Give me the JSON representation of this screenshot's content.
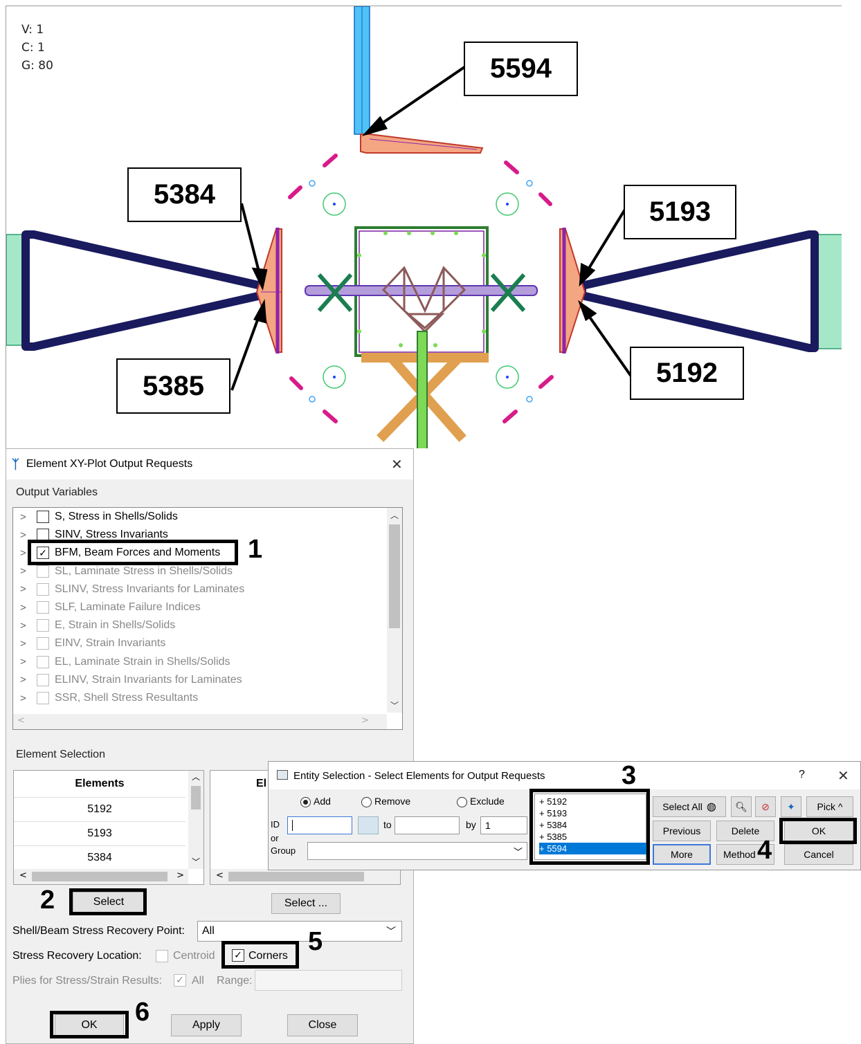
{
  "viewport": {
    "counts": [
      "V: 1",
      "C: 1",
      "G: 80"
    ],
    "callouts": [
      "5594",
      "5384",
      "5193",
      "5385",
      "5192"
    ]
  },
  "main_dialog": {
    "title": "Element XY-Plot Output Requests",
    "close": "✕",
    "output_variables_label": "Output Variables",
    "variables": [
      {
        "label": "S, Stress in Shells/Solids",
        "checked": false,
        "enabled": true
      },
      {
        "label": "SINV, Stress Invariants",
        "checked": false,
        "enabled": true
      },
      {
        "label": "BFM, Beam Forces and Moments",
        "checked": true,
        "enabled": true
      },
      {
        "label": "SL, Laminate Stress in Shells/Solids",
        "checked": false,
        "enabled": false
      },
      {
        "label": "SLINV, Stress Invariants for Laminates",
        "checked": false,
        "enabled": false
      },
      {
        "label": "SLF, Laminate Failure Indices",
        "checked": false,
        "enabled": false
      },
      {
        "label": "E, Strain in Shells/Solids",
        "checked": false,
        "enabled": false
      },
      {
        "label": "EINV, Strain Invariants",
        "checked": false,
        "enabled": false
      },
      {
        "label": "EL, Laminate Strain in Shells/Solids",
        "checked": false,
        "enabled": false
      },
      {
        "label": "ELINV, Strain Invariants for Laminates",
        "checked": false,
        "enabled": false
      },
      {
        "label": "SSR, Shell Stress Resultants",
        "checked": false,
        "enabled": false
      }
    ],
    "element_selection_label": "Element Selection",
    "elements_header": "Elements",
    "elements_header_2": "El",
    "elements": [
      "5192",
      "5193",
      "5384"
    ],
    "select_button": "Select",
    "select_button_2": "Select ...",
    "recovery_point_label": "Shell/Beam Stress Recovery Point:",
    "recovery_point_value": "All",
    "recovery_location_label": "Stress Recovery Location:",
    "centroid_label": "Centroid",
    "corners_label": "Corners",
    "plies_label": "Plies for Stress/Strain Results:",
    "plies_all_label": "All",
    "range_label": "Range:",
    "ok": "OK",
    "apply": "Apply",
    "close_btn": "Close"
  },
  "entity_dialog": {
    "title": "Entity Selection - Select Elements for Output Requests",
    "help": "?",
    "close": "✕",
    "add": "Add",
    "remove": "Remove",
    "exclude": "Exclude",
    "id_label": "ID",
    "or_label": "or",
    "group_label": "Group",
    "to_label": "to",
    "by_label": "by",
    "by_value": "1",
    "ids": [
      "+  5192",
      "+  5193",
      "+  5384",
      "+  5385",
      "+  5594"
    ],
    "select_all": "Select All",
    "pick": "Pick ^",
    "previous": "Previous",
    "delete": "Delete",
    "ok": "OK",
    "more": "More",
    "method": "Method",
    "cancel": "Cancel"
  },
  "steps": [
    "1",
    "2",
    "3",
    "4",
    "5",
    "6"
  ]
}
